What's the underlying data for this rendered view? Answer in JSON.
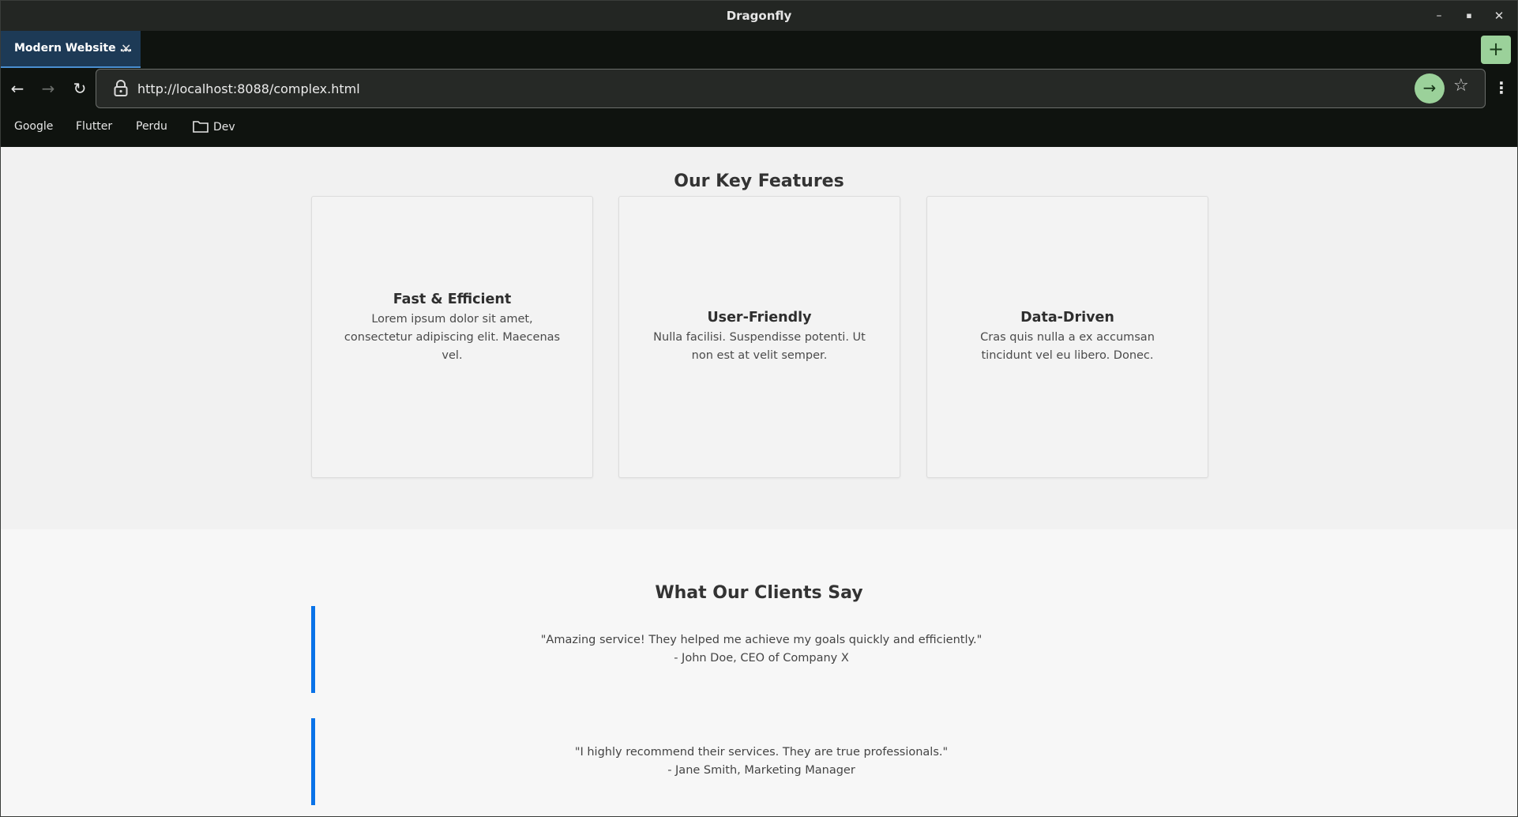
{
  "window": {
    "title": "Dragonfly",
    "controls": {
      "minimize": "–",
      "maximize": "▪",
      "close": "✕"
    }
  },
  "tabs": [
    {
      "label": "Modern Website ...",
      "close": "✕",
      "active": true
    }
  ],
  "new_tab_label": "+",
  "toolbar": {
    "back": "←",
    "forward": "→",
    "reload": "↻",
    "url": "http://localhost:8088/complex.html",
    "go": "→",
    "star": "☆",
    "menu": "⋮"
  },
  "bookmarks": [
    {
      "label": "Google"
    },
    {
      "label": "Flutter"
    },
    {
      "label": "Perdu"
    },
    {
      "label": "Dev",
      "icon": "folder-icon"
    }
  ],
  "page": {
    "features": {
      "title": "Our Key Features",
      "cards": [
        {
          "title": "Fast & Efficient",
          "text": "Lorem ipsum dolor sit amet, consectetur adipiscing elit. Maecenas vel."
        },
        {
          "title": "User-Friendly",
          "text": "Nulla facilisi. Suspendisse potenti. Ut non est at velit semper."
        },
        {
          "title": "Data-Driven",
          "text": "Cras quis nulla a ex accumsan tincidunt vel eu libero. Donec."
        }
      ]
    },
    "testimonials": {
      "title": "What Our Clients Say",
      "quotes": [
        {
          "quote": "\"Amazing service! They helped me achieve my goals quickly and efficiently.\"",
          "author": "- John Doe, CEO of Company X"
        },
        {
          "quote": "\"I highly recommend their services. They are true professionals.\"",
          "author": "- Jane Smith, Marketing Manager"
        }
      ]
    }
  },
  "colors": {
    "accent_green": "#9bd19a",
    "tab_active": "#1d3a56",
    "quote_border": "#0a73e8"
  }
}
